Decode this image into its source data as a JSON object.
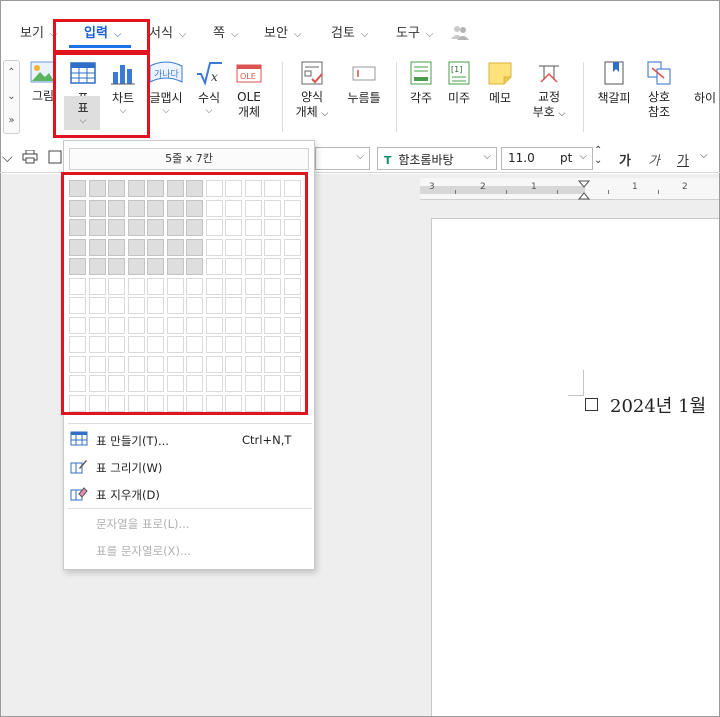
{
  "menu_tabs": [
    {
      "label": "보기",
      "active": false
    },
    {
      "label": "입력",
      "active": true
    },
    {
      "label": "서식",
      "active": false
    },
    {
      "label": "쪽",
      "active": false
    },
    {
      "label": "보안",
      "active": false
    },
    {
      "label": "검토",
      "active": false
    },
    {
      "label": "도구",
      "active": false
    }
  ],
  "ribbon": {
    "picture": "그림",
    "table": "표",
    "chart": "차트",
    "glyph": "글맵시",
    "formula": "수식",
    "ole_line1": "OLE",
    "ole_line2": "개체",
    "form_line1": "양식",
    "form_line2": "개체",
    "click_field": "누름틀",
    "footnote": "각주",
    "endnote": "미주",
    "memo": "메모",
    "proof_line1": "교정",
    "proof_line2": "부호",
    "bookmark": "책갈피",
    "crossref_line1": "상호",
    "crossref_line2": "참조",
    "hyperlink_partial": "하이",
    "chart_icon_text": "가나다",
    "ole_icon_text": "OLE",
    "endnote_icon_text": "[1]"
  },
  "toolbar": {
    "font_name": "함초롬바탕",
    "font_size": "11.0",
    "size_unit": "pt",
    "bold": "가",
    "italic": "가",
    "underline": "가"
  },
  "ruler": {
    "numbers": [
      "3",
      "2",
      "1",
      "1",
      "1",
      "2"
    ]
  },
  "table_dropdown": {
    "size_label": "5줄 x 7칸",
    "grid_rows": 12,
    "grid_cols": 12,
    "selected_rows": 5,
    "selected_cols": 7,
    "items": [
      {
        "label": "표 만들기(T)...",
        "shortcut": "Ctrl+N,T",
        "icon": "table-create-icon",
        "enabled": true
      },
      {
        "label": "표 그리기(W)",
        "shortcut": "",
        "icon": "table-draw-icon",
        "enabled": true
      },
      {
        "label": "표 지우개(D)",
        "shortcut": "",
        "icon": "table-eraser-icon",
        "enabled": true
      },
      {
        "label": "문자열을 표로(L)...",
        "shortcut": "",
        "icon": "",
        "enabled": false
      },
      {
        "label": "표를 문자열로(X)...",
        "shortcut": "",
        "icon": "",
        "enabled": false
      }
    ]
  },
  "document": {
    "text": "2024년 1월"
  },
  "colors": {
    "accent": "#1a73e8",
    "highlight": "#e0141e",
    "selected_cell": "#dedede"
  }
}
